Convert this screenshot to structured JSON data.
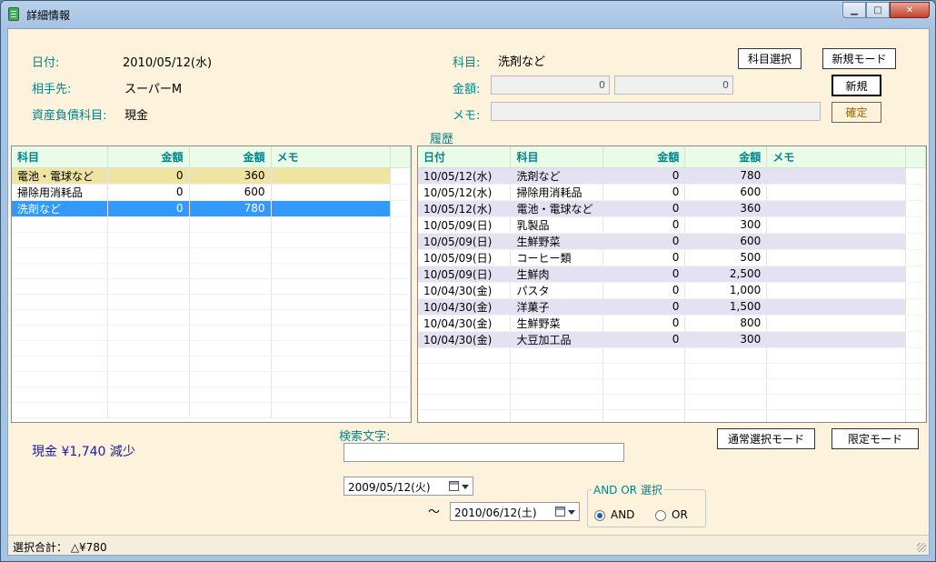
{
  "window": {
    "title": "詳細情報"
  },
  "form": {
    "date_label": "日付:",
    "date_value": "2010/05/12(水)",
    "partner_label": "相手先:",
    "partner_value": "スーパーM",
    "account_label": "資産負債科目:",
    "account_value": "現金",
    "subject_label": "科目:",
    "subject_value": "洗剤など",
    "amount_label": "金額:",
    "amount1": "0",
    "amount2": "0",
    "memo_label": "メモ:",
    "memo_value": ""
  },
  "buttons": {
    "subject_select": "科目選択",
    "new_mode": "新規モード",
    "new": "新規",
    "confirm": "確定",
    "normal_select_mode": "通常選択モード",
    "limited_mode": "限定モード"
  },
  "left_grid": {
    "headers": [
      "科目",
      "金額",
      "金額",
      "メモ"
    ],
    "rows": [
      {
        "subject": "電池・電球など",
        "amount1": "0",
        "amount2": "360",
        "memo": "",
        "style": "yellow"
      },
      {
        "subject": "掃除用消耗品",
        "amount1": "0",
        "amount2": "600",
        "memo": "",
        "style": ""
      },
      {
        "subject": "洗剤など",
        "amount1": "0",
        "amount2": "780",
        "memo": "",
        "style": "sel"
      }
    ]
  },
  "history": {
    "label": "履歴",
    "headers": [
      "日付",
      "科目",
      "金額",
      "金額",
      "メモ"
    ],
    "rows": [
      {
        "date": "10/05/12(水)",
        "subject": "洗剤など",
        "amount1": "0",
        "amount2": "780",
        "memo": "",
        "style": "alt"
      },
      {
        "date": "10/05/12(水)",
        "subject": "掃除用消耗品",
        "amount1": "0",
        "amount2": "600",
        "memo": "",
        "style": ""
      },
      {
        "date": "10/05/12(水)",
        "subject": "電池・電球など",
        "amount1": "0",
        "amount2": "360",
        "memo": "",
        "style": "alt"
      },
      {
        "date": "10/05/09(日)",
        "subject": "乳製品",
        "amount1": "0",
        "amount2": "300",
        "memo": "",
        "style": ""
      },
      {
        "date": "10/05/09(日)",
        "subject": "生鮮野菜",
        "amount1": "0",
        "amount2": "600",
        "memo": "",
        "style": "alt"
      },
      {
        "date": "10/05/09(日)",
        "subject": "コーヒー類",
        "amount1": "0",
        "amount2": "500",
        "memo": "",
        "style": ""
      },
      {
        "date": "10/05/09(日)",
        "subject": "生鮮肉",
        "amount1": "0",
        "amount2": "2,500",
        "memo": "",
        "style": "alt"
      },
      {
        "date": "10/04/30(金)",
        "subject": "パスタ",
        "amount1": "0",
        "amount2": "1,000",
        "memo": "",
        "style": ""
      },
      {
        "date": "10/04/30(金)",
        "subject": "洋菓子",
        "amount1": "0",
        "amount2": "1,500",
        "memo": "",
        "style": "alt"
      },
      {
        "date": "10/04/30(金)",
        "subject": "生鮮野菜",
        "amount1": "0",
        "amount2": "800",
        "memo": "",
        "style": ""
      },
      {
        "date": "10/04/30(金)",
        "subject": "大豆加工品",
        "amount1": "0",
        "amount2": "300",
        "memo": "",
        "style": "alt"
      }
    ]
  },
  "summary": {
    "text": "現金 ¥1,740 減少"
  },
  "search": {
    "label": "検索文字:",
    "value": "",
    "from_date": "2009/05/12(火)",
    "tilde": "～",
    "to_date": "2010/06/12(土)"
  },
  "and_or": {
    "title": "AND OR 選択",
    "and_label": "AND",
    "or_label": "OR",
    "selected": "AND"
  },
  "status": {
    "text": "選択合計：  △¥780"
  },
  "colors": {
    "label_teal": "#00868b",
    "selected_blue": "#3399ff",
    "row_yellow": "#efe4a2",
    "background": "#fdf3dc"
  }
}
